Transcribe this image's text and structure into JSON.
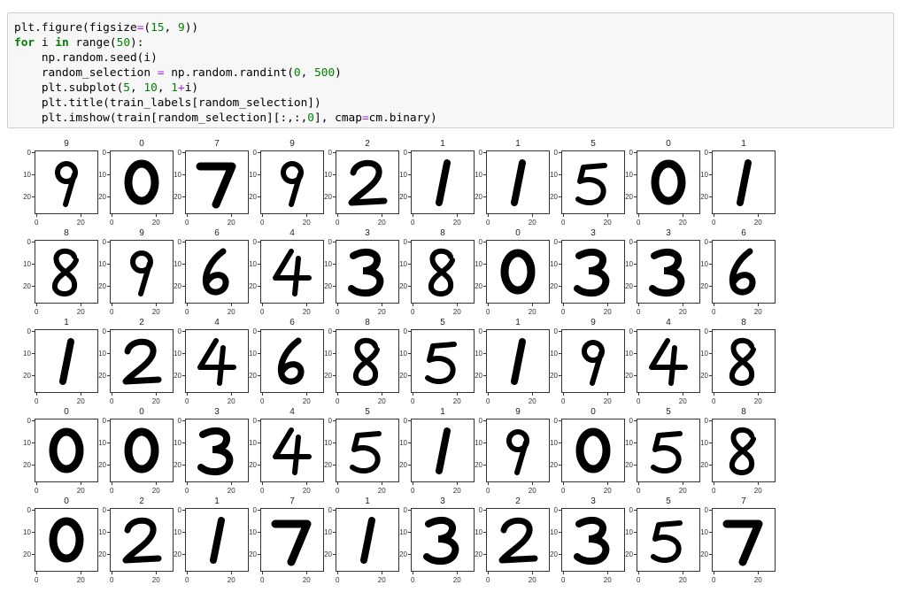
{
  "code_cell": {
    "lines": [
      [
        {
          "t": "plt.figure(figsize"
        },
        {
          "t": "=",
          "c": "op"
        },
        {
          "t": "("
        },
        {
          "t": "15",
          "c": "num"
        },
        {
          "t": ", "
        },
        {
          "t": "9",
          "c": "num"
        },
        {
          "t": "))"
        }
      ],
      [
        {
          "t": "for",
          "c": "kw"
        },
        {
          "t": " i "
        },
        {
          "t": "in",
          "c": "kw"
        },
        {
          "t": " range("
        },
        {
          "t": "50",
          "c": "num"
        },
        {
          "t": "):"
        }
      ],
      [
        {
          "t": "    np.random.seed(i)"
        }
      ],
      [
        {
          "t": "    random_selection "
        },
        {
          "t": "=",
          "c": "op"
        },
        {
          "t": " np.random.randint("
        },
        {
          "t": "0",
          "c": "num"
        },
        {
          "t": ", "
        },
        {
          "t": "500",
          "c": "num"
        },
        {
          "t": ")"
        }
      ],
      [
        {
          "t": "    plt.subplot("
        },
        {
          "t": "5",
          "c": "num"
        },
        {
          "t": ", "
        },
        {
          "t": "10",
          "c": "num"
        },
        {
          "t": ", "
        },
        {
          "t": "1",
          "c": "num"
        },
        {
          "t": "+",
          "c": "op"
        },
        {
          "t": "i)"
        }
      ],
      [
        {
          "t": "    plt.title(train_labels[random_selection])"
        }
      ],
      [
        {
          "t": "    plt.imshow(train[random_selection][:,:,"
        },
        {
          "t": "0",
          "c": "num"
        },
        {
          "t": "], cmap"
        },
        {
          "t": "=",
          "c": "op"
        },
        {
          "t": "cm.binary)"
        }
      ]
    ]
  },
  "subplot_axes": {
    "y_ticks": [
      "0",
      "10",
      "20"
    ],
    "x_ticks": [
      "0",
      "20"
    ]
  },
  "subplot_titles": [
    "9",
    "0",
    "7",
    "9",
    "2",
    "1",
    "1",
    "5",
    "0",
    "1",
    "8",
    "9",
    "6",
    "4",
    "3",
    "8",
    "0",
    "3",
    "3",
    "6",
    "1",
    "2",
    "4",
    "6",
    "8",
    "5",
    "1",
    "9",
    "4",
    "8",
    "0",
    "0",
    "3",
    "4",
    "5",
    "1",
    "9",
    "0",
    "5",
    "8",
    "0",
    "2",
    "1",
    "7",
    "1",
    "3",
    "2",
    "3",
    "5",
    "7"
  ],
  "digit_image_colormap": "binary"
}
